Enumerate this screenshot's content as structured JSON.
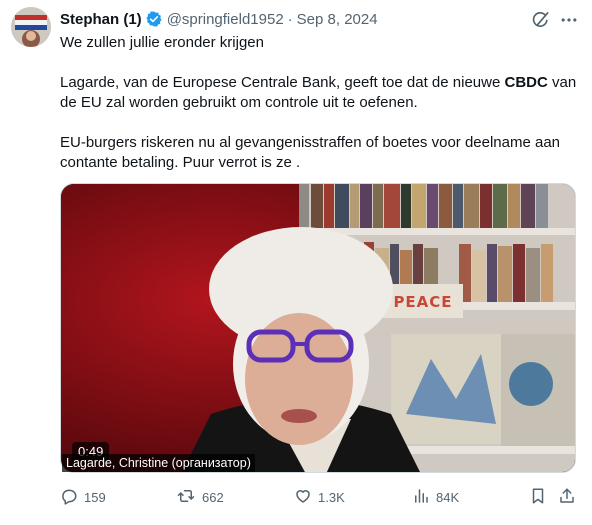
{
  "user": {
    "display_name": "Stephan (1)",
    "handle": "@springfield1952",
    "separator": "·",
    "date": "Sep 8, 2024",
    "verified": true
  },
  "tweet": {
    "line1": "We zullen jullie eronder krijgen",
    "para2_before": "Lagarde, van de Europese Centrale Bank, geeft toe dat de nieuwe ",
    "para2_bold": "CBDC",
    "para2_after": " van de EU zal worden gebruikt om controle uit te oefenen.",
    "para3": "EU-burgers riskeren nu al gevangenisstraffen of boetes voor deelname aan contante betaling. Puur verrot is ze ."
  },
  "video": {
    "duration": "0:49",
    "caption": "Lagarde, Christine (организатор)",
    "sign_text": "PEACE"
  },
  "actions": {
    "replies": "159",
    "reposts": "662",
    "likes": "1.3K",
    "views": "84K"
  },
  "icons": {
    "verified": "verified-badge-icon",
    "grok": "grok-icon",
    "more": "more-icon",
    "reply": "reply-icon",
    "retweet": "retweet-icon",
    "like": "heart-icon",
    "views": "views-icon",
    "bookmark": "bookmark-icon",
    "share": "share-icon"
  },
  "colors": {
    "text": "#0f1419",
    "muted": "#536471",
    "verified": "#1d9bf0"
  }
}
